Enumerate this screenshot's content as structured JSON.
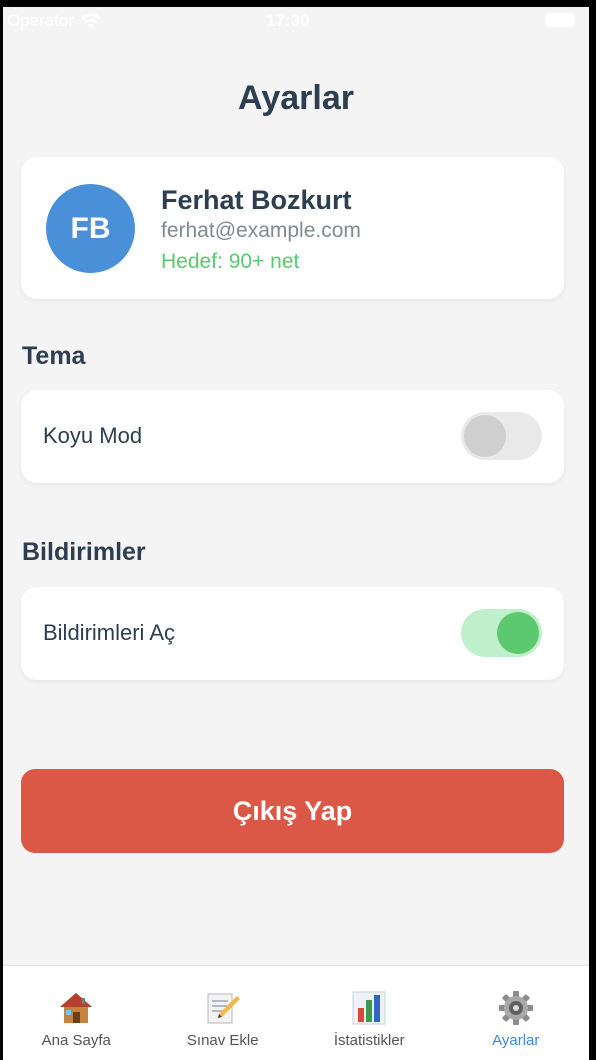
{
  "status_bar": {
    "carrier": "Operator",
    "time": "17:30"
  },
  "page": {
    "title": "Ayarlar"
  },
  "profile": {
    "initials": "FB",
    "name": "Ferhat Bozkurt",
    "email": "ferhat@example.com",
    "goal": "Hedef: 90+ net",
    "avatar_color": "#4a90d9"
  },
  "sections": {
    "theme": {
      "title": "Tema",
      "row_label": "Koyu Mod",
      "enabled": false
    },
    "notifications": {
      "title": "Bildirimler",
      "row_label": "Bildirimleri Aç",
      "enabled": true
    }
  },
  "logout": {
    "label": "Çıkış Yap",
    "color": "#db5746"
  },
  "tabs": [
    {
      "label": "Ana Sayfa",
      "icon": "house-icon",
      "active": false
    },
    {
      "label": "Sınav Ekle",
      "icon": "memo-pencil-icon",
      "active": false
    },
    {
      "label": "İstatistikler",
      "icon": "bar-chart-icon",
      "active": false
    },
    {
      "label": "Ayarlar",
      "icon": "gear-icon",
      "active": true
    }
  ],
  "colors": {
    "accent": "#3b8be0",
    "success": "#5cc96f",
    "text": "#2c3e50"
  }
}
